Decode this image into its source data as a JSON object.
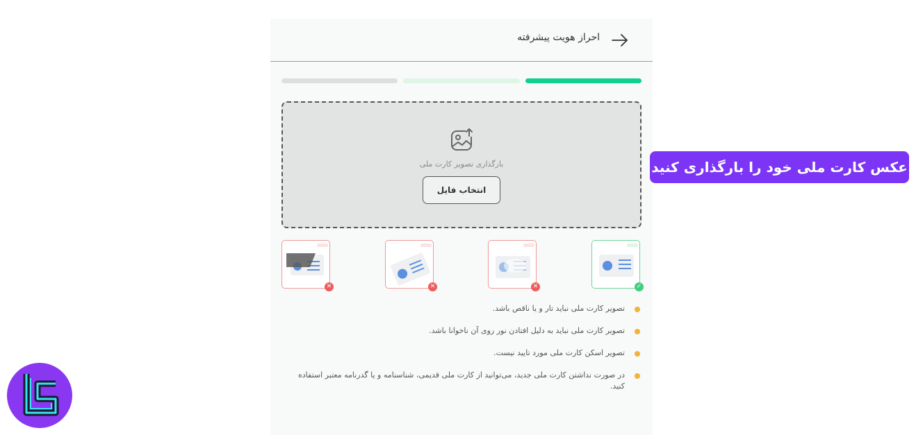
{
  "header": {
    "title": "احراز هویت پیشرفته",
    "back_icon": "arrow-right-icon"
  },
  "progress": {
    "active_color": "#10d08f",
    "next_color": "#dff5e6",
    "inactive_color": "#dcdfe0",
    "current_step": 1,
    "total_steps": 3
  },
  "upload": {
    "icon": "image-upload-icon",
    "label": "بارگذاری تصویر کارت ملی",
    "button_label": "انتخاب فایل"
  },
  "samples": [
    {
      "status": "valid",
      "badge": "✓",
      "color": "#3fcf7f"
    },
    {
      "status": "invalid",
      "badge": "✕",
      "color": "#ef5b5b"
    },
    {
      "status": "invalid",
      "badge": "✕",
      "color": "#ef5b5b"
    },
    {
      "status": "invalid",
      "badge": "✕",
      "color": "#ef5b5b"
    }
  ],
  "rules": [
    "تصویر کارت ملی نباید تار و یا ناقص باشد.",
    "تصویر کارت ملی نباید به دلیل افتادن نور روی آن ناخوانا باشد.",
    "تصویر اسکن کارت ملی مورد تایید نیست.",
    "در صورت نداشتن کارت ملی جدید، می‌توانید از کارت ملی قدیمی، شناسنامه و یا گدرنامه معتبر استفاده کنید."
  ],
  "callout": {
    "text": "عکس کارت ملی خود را بارگذاری کنید",
    "color": "#7c35f5"
  },
  "logo": {
    "icon": "brand-logo-icon",
    "color": "#8a37f2"
  }
}
